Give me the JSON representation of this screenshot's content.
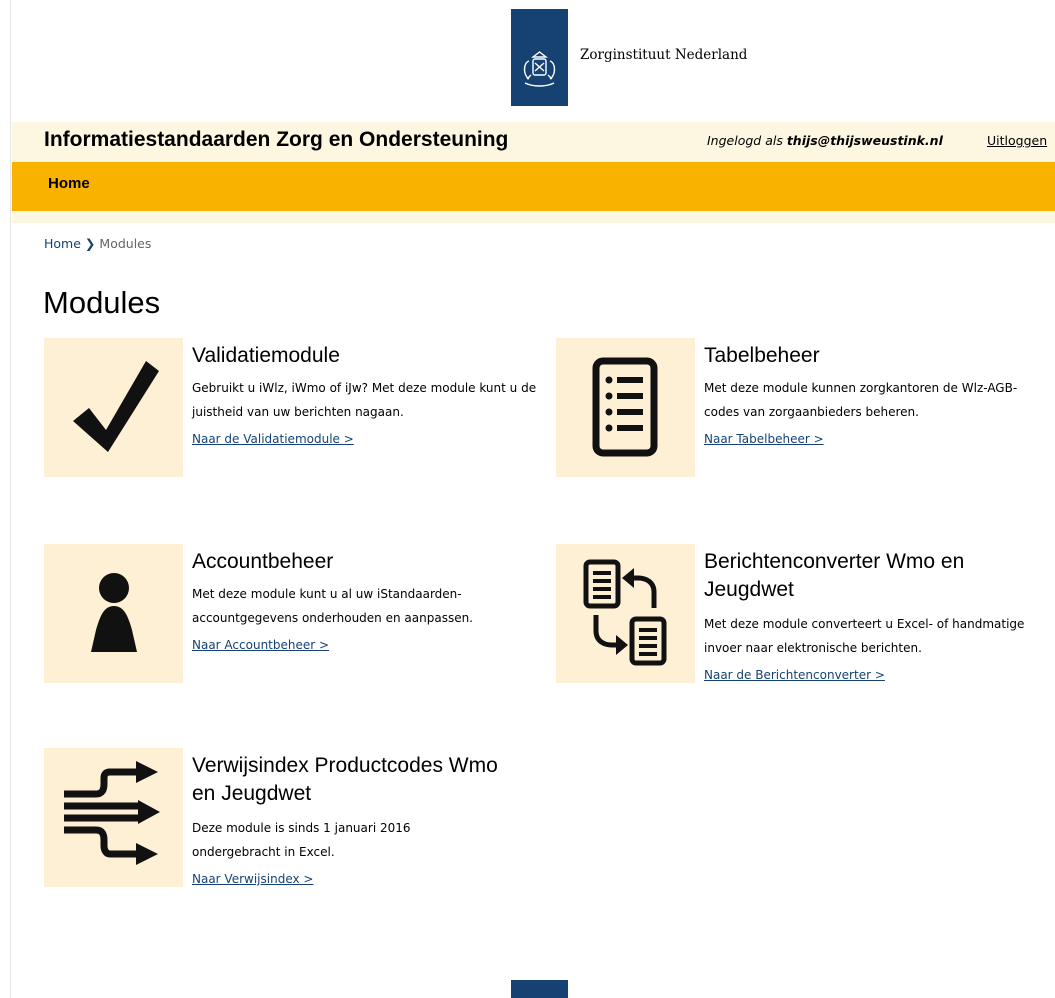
{
  "header": {
    "organization": "Zorginstituut Nederland",
    "site_title": "Informatiestandaarden Zorg en Ondersteuning",
    "login_prefix": "Ingelogd als",
    "login_user": "thijs@thijsweustink.nl",
    "logout_label": "Uitloggen",
    "brand_color": "#154273",
    "accent_color": "#f9b200"
  },
  "nav": {
    "home_label": "Home"
  },
  "breadcrumb": {
    "home": "Home",
    "separator": "❯",
    "current": "Modules"
  },
  "page": {
    "title": "Modules"
  },
  "modules": [
    {
      "icon": "checkmark-icon",
      "title": "Validatiemodule",
      "description": "Gebruikt u iWlz, iWmo of iJw? Met deze module kunt u de juistheid van uw berichten nagaan.",
      "link": "Naar de Validatiemodule >"
    },
    {
      "icon": "list-document-icon",
      "title": "Tabelbeheer",
      "description": "Met deze module kunnen zorgkantoren de Wlz-AGB-codes van zorgaanbieders beheren.",
      "link": "Naar Tabelbeheer >"
    },
    {
      "icon": "person-icon",
      "title": "Accountbeheer",
      "description": "Met deze module kunt u al uw iStandaarden-accountgegevens onderhouden en aanpassen.",
      "link": "Naar Accountbeheer >"
    },
    {
      "icon": "convert-documents-icon",
      "title": "Berichtenconverter Wmo en Jeugdwet",
      "description": "Met deze module converteert u Excel- of handmatige invoer naar elektronische berichten.",
      "link": "Naar de Berichtenconverter >"
    },
    {
      "icon": "redirect-arrows-icon",
      "title": "Verwijsindex Productcodes Wmo en Jeugdwet",
      "description": "Deze module is sinds 1 januari 2016 ondergebracht in Excel.",
      "link": "Naar Verwijsindex >"
    }
  ]
}
